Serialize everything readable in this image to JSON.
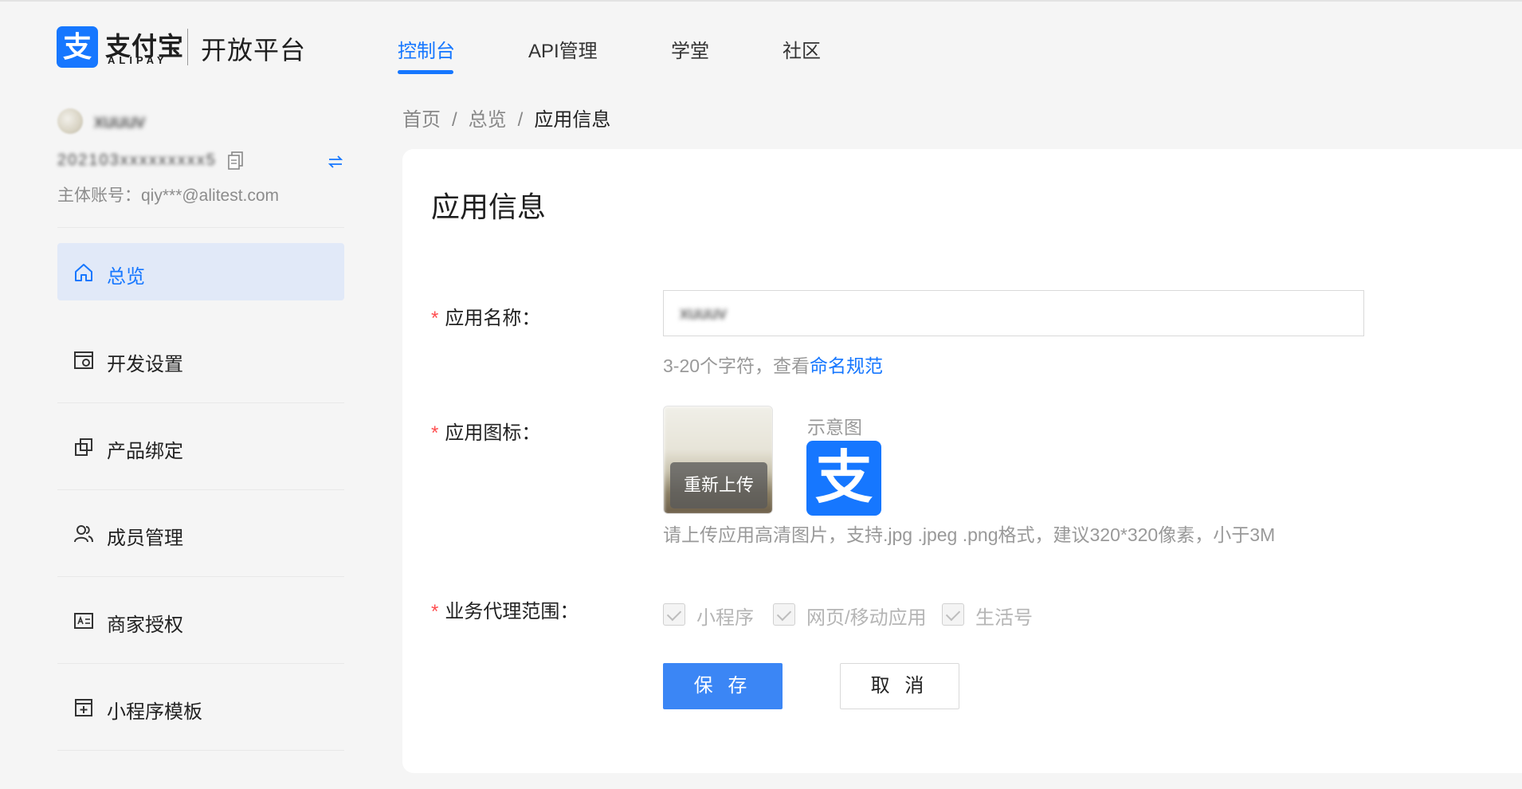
{
  "header": {
    "logo_mark": "支",
    "logo_cn": "支付宝",
    "logo_en": "ALIPAY",
    "platform": "开放平台",
    "nav": [
      {
        "label": "控制台",
        "active": true
      },
      {
        "label": "API管理",
        "active": false
      },
      {
        "label": "学堂",
        "active": false
      },
      {
        "label": "社区",
        "active": false
      }
    ]
  },
  "sidebar": {
    "account": {
      "name": "xuuuv",
      "id": "202103xxxxxxxxx5",
      "main_account": "主体账号：qiy***@alitest.com"
    },
    "menu": [
      {
        "label": "总览",
        "icon": "home-icon",
        "active": true
      },
      {
        "label": "开发设置",
        "icon": "dev-settings-icon",
        "active": false
      },
      {
        "label": "产品绑定",
        "icon": "product-bind-icon",
        "active": false
      },
      {
        "label": "成员管理",
        "icon": "members-icon",
        "active": false
      },
      {
        "label": "商家授权",
        "icon": "merchant-auth-icon",
        "active": false
      },
      {
        "label": "小程序模板",
        "icon": "template-icon",
        "active": false
      }
    ]
  },
  "breadcrumb": {
    "items": [
      "首页",
      "总览",
      "应用信息"
    ],
    "separator": "/"
  },
  "form": {
    "title": "应用信息",
    "app_name": {
      "label": "应用名称：",
      "value": "xuuuv",
      "hint_prefix": "3-20个字符，查看",
      "hint_link": "命名规范"
    },
    "app_icon": {
      "label": "应用图标：",
      "reupload": "重新上传",
      "sample_label": "示意图",
      "sample_mark": "支",
      "hint": "请上传应用高清图片，支持.jpg .jpeg .png格式，建议320*320像素，小于3M"
    },
    "scope": {
      "label": "业务代理范围：",
      "options": [
        {
          "label": "小程序",
          "checked": true,
          "disabled": true
        },
        {
          "label": "网页/移动应用",
          "checked": true,
          "disabled": true
        },
        {
          "label": "生活号",
          "checked": true,
          "disabled": true
        }
      ]
    },
    "save_label": "保 存",
    "cancel_label": "取 消"
  },
  "colors": {
    "accent": "#1677ff",
    "primary_button": "#3b86f5",
    "active_menu_bg": "#e1e9f8",
    "required": "#ff4d4f"
  }
}
